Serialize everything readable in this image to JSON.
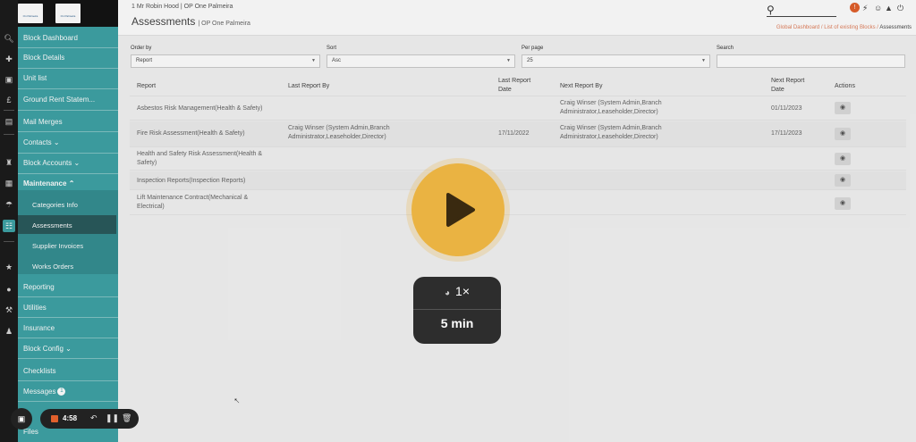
{
  "user_line": "1 Mr Robin Hood",
  "org_line": "OP One Palmeira",
  "page": {
    "title": "Assessments",
    "subtitle": "OP One Palmeira"
  },
  "breadcrumbs": {
    "b1": "Global Dashboard",
    "b2": "List of existing Blocks",
    "b3": "Assessments"
  },
  "logo_text": "On Palmeira",
  "sidebar": {
    "block_dashboard": "Block Dashboard",
    "block_details": "Block Details",
    "unit_list": "Unit list",
    "ground_rent": "Ground Rent Statem...",
    "mail_merges": "Mail Merges",
    "contacts": "Contacts",
    "block_accounts": "Block Accounts",
    "maintenance": "Maintenance",
    "categories_info": "Categories Info",
    "assessments": "Assessments",
    "supplier_invoices": "Supplier Invoices",
    "works_orders": "Works Orders",
    "reporting": "Reporting",
    "utilities": "Utilities",
    "insurance": "Insurance",
    "block_config": "Block Config",
    "checklists": "Checklists",
    "messages": "Messages",
    "messages_count": "1",
    "files": "Files"
  },
  "filters": {
    "order_by_label": "Order by",
    "order_by_value": "Report",
    "sort_label": "Sort",
    "sort_value": "Asc",
    "per_page_label": "Per page",
    "per_page_value": "25",
    "search_label": "Search"
  },
  "table": {
    "headers": {
      "report": "Report",
      "last_by": "Last Report By",
      "last_date_1": "Last Report",
      "last_date_2": "Date",
      "next_by": "Next Report By",
      "next_date_1": "Next Report",
      "next_date_2": "Date",
      "actions": "Actions"
    },
    "rows": [
      {
        "report_1": "Asbestos Risk Management(Health & Safety)",
        "report_2": "",
        "last_by_1": "",
        "last_by_2": "",
        "last_date": "",
        "next_by_1": "Craig Winser (System Admin,Branch",
        "next_by_2": "Administrator,Leaseholder,Director)",
        "next_date": "01/11/2023"
      },
      {
        "report_1": "Fire Risk Assessment(Health & Safety)",
        "report_2": "",
        "last_by_1": "Craig Winser (System Admin,Branch",
        "last_by_2": "Administrator,Leaseholder,Director)",
        "last_date": "17/11/2022",
        "next_by_1": "Craig Winser (System Admin,Branch",
        "next_by_2": "Administrator,Leaseholder,Director)",
        "next_date": "17/11/2023"
      },
      {
        "report_1": "Health and Safety Risk Assessment(Health &",
        "report_2": "Safety)",
        "last_by_1": "",
        "last_by_2": "",
        "last_date": "",
        "next_by_1": "",
        "next_by_2": "",
        "next_date": ""
      },
      {
        "report_1": "Inspection Reports(Inspection Reports)",
        "report_2": "",
        "last_by_1": "",
        "last_by_2": "",
        "last_date": "",
        "next_by_1": "",
        "next_by_2": "",
        "next_date": ""
      },
      {
        "report_1": "Lift Maintenance Contract(Mechanical &",
        "report_2": "Electrical)",
        "last_by_1": "",
        "last_by_2": "",
        "last_date": "",
        "next_by_1": "",
        "next_by_2": "",
        "next_date": ""
      }
    ]
  },
  "video": {
    "speed": "1×",
    "duration": "5 min"
  },
  "recorder": {
    "time": "4:58"
  },
  "colors": {
    "sidebar": "#3fa3a6",
    "accent": "#eab342",
    "crumb": "#e07f5c"
  }
}
